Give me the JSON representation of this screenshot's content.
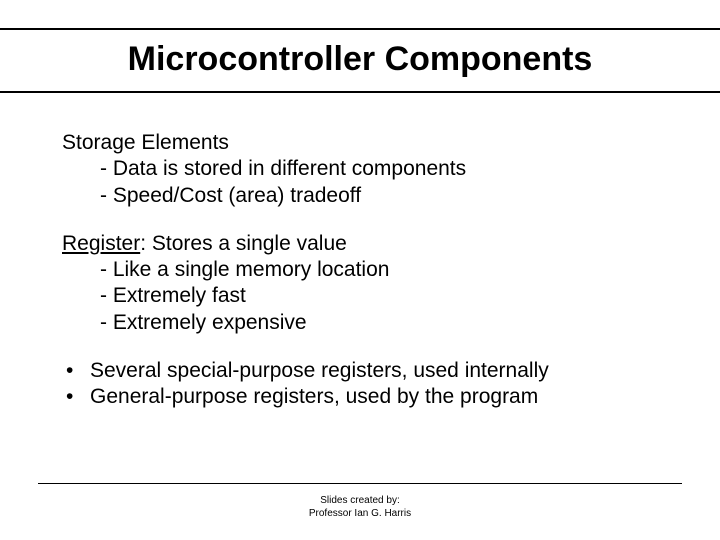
{
  "title": "Microcontroller Components",
  "block1": {
    "heading": "Storage Elements",
    "items": [
      "- Data is stored in different components",
      "- Speed/Cost (area) tradeoff"
    ]
  },
  "block2": {
    "term": "Register",
    "afterTerm": ": Stores a single value",
    "items": [
      "- Like a single memory location",
      "- Extremely fast",
      "- Extremely expensive"
    ]
  },
  "block3": {
    "bullets": [
      "Several special-purpose registers, used internally",
      "General-purpose registers, used by the program"
    ]
  },
  "footer": {
    "line1": "Slides created by:",
    "line2": "Professor Ian G. Harris"
  }
}
